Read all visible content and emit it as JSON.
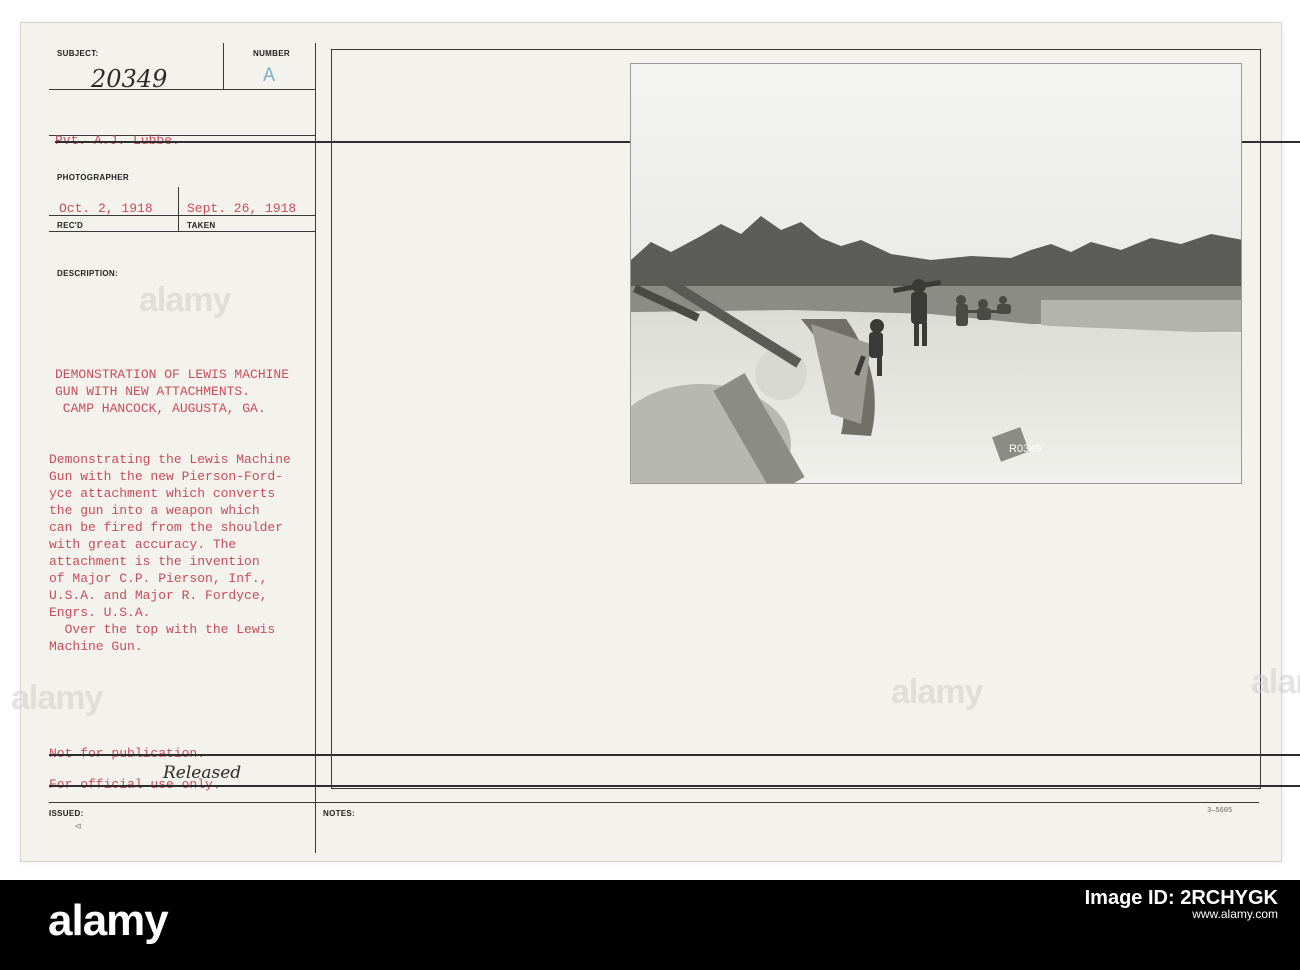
{
  "card": {
    "labels": {
      "subject": "SUBJECT:",
      "number": "NUMBER",
      "photographer": "PHOTOGRAPHER",
      "received": "REC'D",
      "taken": "TAKEN",
      "description": "DESCRIPTION:",
      "issued": "ISSUED:",
      "notes": "NOTES:"
    },
    "subject_number_handwritten": "20349",
    "number_letter": "A",
    "photographer_name": "Pvt. A.J. Lubbe.",
    "received_date": "Oct. 2, 1918",
    "taken_date": "Sept. 26, 1918",
    "description_title": [
      "DEMONSTRATION OF LEWIS MACHINE",
      "GUN WITH NEW ATTACHMENTS.",
      " CAMP HANCOCK, AUGUSTA, GA."
    ],
    "description_body": [
      "Demonstrating the Lewis Machine",
      "Gun with the new Pierson-Ford-",
      "yce attachment which converts",
      "the gun into a weapon which",
      "can be fired from the shoulder",
      "with great accuracy. The",
      "attachment is the invention",
      "of Major C.P. Pierson, Inf.,",
      "U.S.A. and Major R. Fordyce,",
      "Engrs. U.S.A.",
      "  Over the top with the Lewis",
      "Machine Gun."
    ],
    "restriction_lines": [
      "Not for publication.",
      "For official use only."
    ],
    "released_handwritten": "Released",
    "issued_mark": "◃",
    "form_code": "3—5605",
    "photo_stamp": "R0349"
  },
  "watermark": "alamy",
  "footer": {
    "logo": "alamy",
    "image_id_label": "Image ID: 2RCHYGK",
    "site": "www.alamy.com"
  }
}
